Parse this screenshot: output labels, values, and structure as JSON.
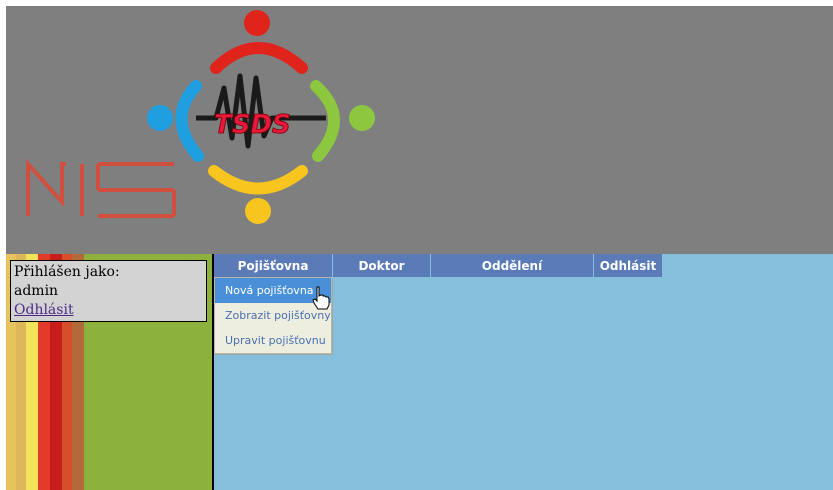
{
  "header": {
    "logo_tsds_text": "TSDS",
    "logo_nis_text": "NIS"
  },
  "login": {
    "label": "Přihlášen jako:",
    "username": "admin",
    "logout_link": "Odhlásit"
  },
  "menu": {
    "items": [
      {
        "label": "Pojišťovna"
      },
      {
        "label": "Doktor"
      },
      {
        "label": "Oddělení"
      },
      {
        "label": "Odhlásit"
      }
    ],
    "dropdown": [
      {
        "label": "Nová pojišťovna",
        "active": true
      },
      {
        "label": "Zobrazit pojišťovny",
        "active": false
      },
      {
        "label": "Upravit pojišťovnu",
        "active": false
      }
    ]
  },
  "colors": {
    "header_bg": "#7f7f7f",
    "content_bg": "#86bfdb",
    "menu_bg": "#5b7ab8",
    "left_bg": "#8cb13c"
  }
}
